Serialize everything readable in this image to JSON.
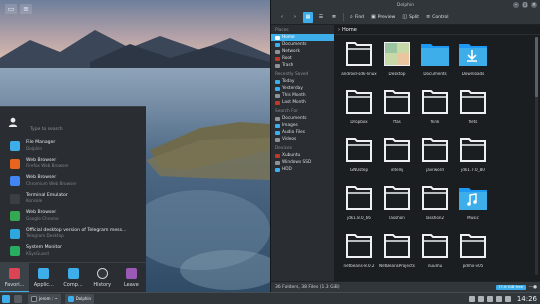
{
  "launcher": {
    "search_placeholder": "Type to search",
    "apps": [
      {
        "name": "File Manager",
        "sub": "Dolphin",
        "color": "#3daee9"
      },
      {
        "name": "Web Browser",
        "sub": "Firefox Web Browser",
        "color": "#e8641f"
      },
      {
        "name": "Web Browser",
        "sub": "Chromium Web Browser",
        "color": "#4285f4"
      },
      {
        "name": "Terminal Emulator",
        "sub": "Konsole",
        "color": "#3a3f44"
      },
      {
        "name": "Web Browser",
        "sub": "Google Chrome",
        "color": "#34a853"
      },
      {
        "name": "Official desktop version of Telegram mess...",
        "sub": "Telegram Desktop",
        "color": "#2ea6de"
      },
      {
        "name": "System Monitor",
        "sub": "KSysGuard",
        "color": "#27ae60"
      }
    ],
    "tabs": [
      {
        "label": "Favori...",
        "color": "#da4453"
      },
      {
        "label": "Applic...",
        "color": "#3daee9"
      },
      {
        "label": "Comp...",
        "color": "#3daee9"
      },
      {
        "label": "History",
        "color": "#31363b"
      },
      {
        "label": "Leave",
        "color": "#9b59b6"
      }
    ]
  },
  "dolphin": {
    "title": "Dolphin",
    "toolbar": {
      "find": "Find",
      "preview": "Preview",
      "split": "Split",
      "control": "Control"
    },
    "places": [
      {
        "kind": "header",
        "label": "Places"
      },
      {
        "kind": "item",
        "label": "Home",
        "selected": true
      },
      {
        "kind": "item",
        "label": "Documents"
      },
      {
        "kind": "item",
        "label": "Network"
      },
      {
        "kind": "item",
        "label": "Root"
      },
      {
        "kind": "item",
        "label": "Trash"
      },
      {
        "kind": "header",
        "label": "Recently Saved"
      },
      {
        "kind": "item",
        "label": "Today"
      },
      {
        "kind": "item",
        "label": "Yesterday"
      },
      {
        "kind": "item",
        "label": "This Month"
      },
      {
        "kind": "item",
        "label": "Last Month"
      },
      {
        "kind": "header",
        "label": "Search For"
      },
      {
        "kind": "item",
        "label": "Documents"
      },
      {
        "kind": "item",
        "label": "Images"
      },
      {
        "kind": "item",
        "label": "Audio Files"
      },
      {
        "kind": "item",
        "label": "Videos"
      },
      {
        "kind": "header",
        "label": "Devices"
      },
      {
        "kind": "item",
        "label": "Xubuntu"
      },
      {
        "kind": "item",
        "label": "Windows SSD"
      },
      {
        "kind": "item",
        "label": "HDD"
      }
    ],
    "breadcrumb": "Home",
    "files": [
      {
        "label": "android-sdk-linux",
        "type": "folder"
      },
      {
        "label": "Desktop",
        "type": "desktop"
      },
      {
        "label": "Documents",
        "type": "folder-blue"
      },
      {
        "label": "Downloads",
        "type": "folder-download"
      },
      {
        "label": "",
        "type": "empty"
      },
      {
        "label": "Dropbox",
        "type": "folder"
      },
      {
        "label": "ffas",
        "type": "folder"
      },
      {
        "label": "flink",
        "type": "folder"
      },
      {
        "label": "flets",
        "type": "folder"
      },
      {
        "label": "",
        "type": "empty"
      },
      {
        "label": "GNUstep",
        "type": "folder"
      },
      {
        "label": "intellij",
        "type": "folder"
      },
      {
        "label": "javrword",
        "type": "folder"
      },
      {
        "label": "jdk1.7.0_80",
        "type": "folder"
      },
      {
        "label": "",
        "type": "empty"
      },
      {
        "label": "jdk1.8.0_66",
        "type": "folder"
      },
      {
        "label": "lasshon",
        "type": "folder"
      },
      {
        "label": "lasshon2",
        "type": "folder"
      },
      {
        "label": "Music",
        "type": "folder-music"
      },
      {
        "label": "",
        "type": "empty"
      },
      {
        "label": "netbeans-8.0.2",
        "type": "folder"
      },
      {
        "label": "NetBeansProjects",
        "type": "folder"
      },
      {
        "label": "nuumu",
        "type": "folder"
      },
      {
        "label": "pdmx-v05",
        "type": "folder"
      }
    ],
    "status": "36 Folders, 38 Files (1.3 GiB)",
    "free_space": "77.6 GiB free"
  },
  "taskbar": {
    "task1": "jerom : ~",
    "task2": "Dolphin",
    "clock": "14:26"
  }
}
